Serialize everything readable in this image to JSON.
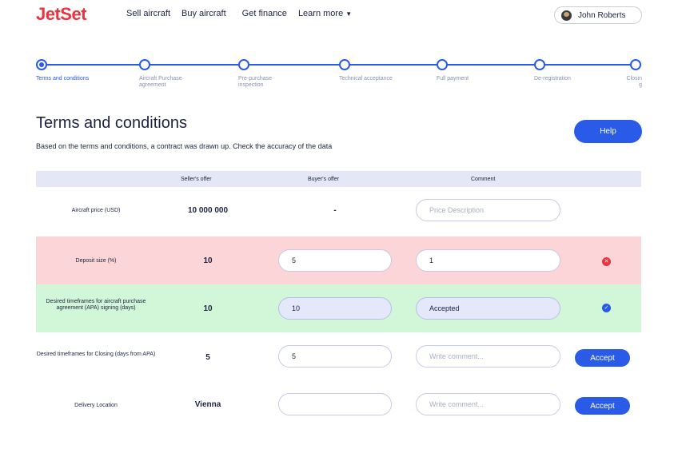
{
  "header": {
    "logo": "JetSet",
    "nav": [
      {
        "label": "Sell aircraft"
      },
      {
        "label": "Buy aircraft"
      },
      {
        "label": "Get finance"
      },
      {
        "label": "Learn more"
      }
    ],
    "user_name": "John Roberts"
  },
  "stepper": {
    "steps": [
      {
        "label": "Terms and conditions"
      },
      {
        "label": "Aircraft Purchase agreement"
      },
      {
        "label": "Pre-purchase inspection"
      },
      {
        "label": "Technical acceptance"
      },
      {
        "label": "Full payment"
      },
      {
        "label": "De-registration"
      },
      {
        "label": "Closing"
      }
    ],
    "active_index": 0
  },
  "page": {
    "title": "Terms and conditions",
    "subtitle": "Based on the terms and conditions, a contract was drawn up. Check the accuracy of the data",
    "help_label": "Help"
  },
  "table": {
    "columns": [
      "Seller's offer",
      "Buyer's offer",
      "Comment"
    ],
    "rows": [
      {
        "label": "Aircraft price (USD)",
        "seller": "10 000 000",
        "buyer": "-",
        "comment_placeholder": "Price Description"
      },
      {
        "label": "Deposit size (%)",
        "seller": "10",
        "buyer": "5",
        "comment": "1",
        "status": "rejected"
      },
      {
        "label": "Desired timeframes for aircraft purchase agreement (APA) signing (days)",
        "seller": "10",
        "buyer": "10",
        "comment": "Accepted",
        "status": "accepted"
      },
      {
        "label": "Desired timeframes for Closing (days from APA)",
        "seller": "5",
        "buyer": "5",
        "comment_placeholder": "Write comment...",
        "action": "Accept"
      },
      {
        "label": "Delivery Location",
        "seller": "Vienna",
        "buyer": "",
        "comment_placeholder": "Write comment...",
        "action": "Accept"
      }
    ]
  },
  "colors": {
    "brand": "#e8343f",
    "accent": "#2a5be8",
    "rejected_row": "#fbd5d8",
    "accepted_row": "#d2f6d8"
  }
}
